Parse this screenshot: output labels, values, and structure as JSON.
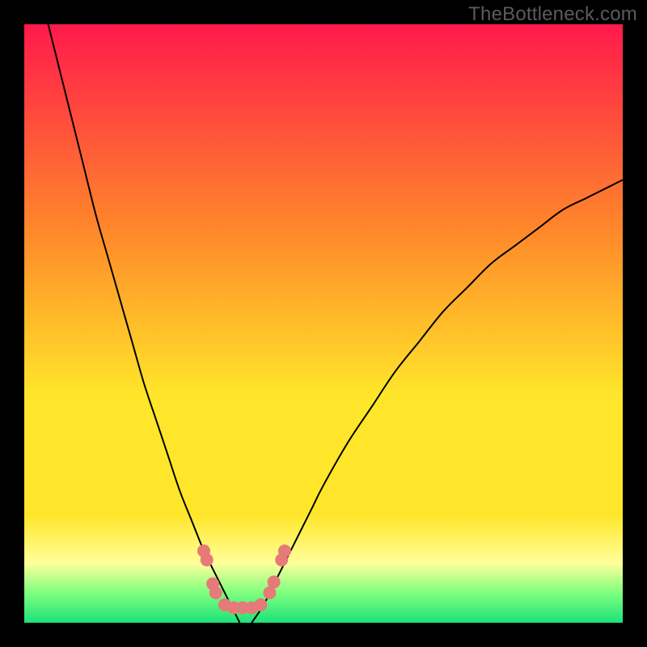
{
  "watermark": "TheBottleneck.com",
  "chart_data": {
    "type": "line",
    "title": "",
    "xlabel": "",
    "ylabel": "",
    "xlim": [
      0,
      100
    ],
    "ylim": [
      0,
      100
    ],
    "grid": false,
    "legend": false,
    "gradient_colors": {
      "top": "#ff1a4b",
      "mid_orange": "#ff8a2a",
      "yellow": "#ffe62a",
      "pale_yellow": "#ffff9a",
      "light_green": "#7eff7e",
      "green": "#1de27a"
    },
    "series": [
      {
        "name": "bottleneck-curve-left",
        "x": [
          4,
          6,
          8,
          10,
          12,
          14,
          16,
          18,
          20,
          22,
          24,
          26,
          28,
          30,
          31,
          32,
          33,
          34,
          35,
          36
        ],
        "y": [
          100,
          92,
          84,
          76,
          68,
          61,
          54,
          47,
          40,
          34,
          28,
          22,
          17,
          12,
          10,
          8,
          6,
          4,
          2,
          0
        ],
        "color": "#000000",
        "weight": 2
      },
      {
        "name": "bottleneck-curve-right",
        "x": [
          38,
          40,
          42,
          44,
          46,
          48,
          50,
          54,
          58,
          62,
          66,
          70,
          74,
          78,
          82,
          86,
          90,
          94,
          98,
          100
        ],
        "y": [
          0,
          3,
          7,
          11,
          15,
          19,
          23,
          30,
          36,
          42,
          47,
          52,
          56,
          60,
          63,
          66,
          69,
          71,
          73,
          74
        ],
        "color": "#000000",
        "weight": 2
      }
    ],
    "markers": {
      "name": "highlight-points",
      "color": "#e67a78",
      "radius": 8,
      "points": [
        {
          "x": 30.0,
          "y": 12.0
        },
        {
          "x": 30.5,
          "y": 10.5
        },
        {
          "x": 31.5,
          "y": 6.5
        },
        {
          "x": 32.0,
          "y": 5.0
        },
        {
          "x": 33.5,
          "y": 3.0
        },
        {
          "x": 35.0,
          "y": 2.5
        },
        {
          "x": 36.5,
          "y": 2.5
        },
        {
          "x": 38.0,
          "y": 2.5
        },
        {
          "x": 39.5,
          "y": 3.0
        },
        {
          "x": 41.0,
          "y": 5.0
        },
        {
          "x": 41.7,
          "y": 6.8
        },
        {
          "x": 43.0,
          "y": 10.5
        },
        {
          "x": 43.5,
          "y": 12.0
        }
      ]
    }
  }
}
